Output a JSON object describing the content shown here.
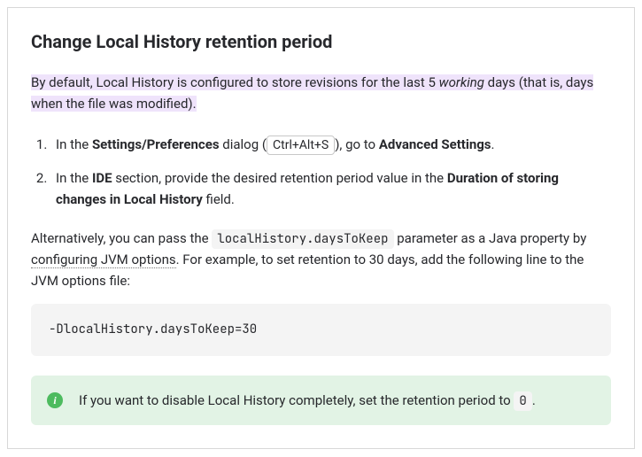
{
  "heading": "Change Local History retention period",
  "intro": {
    "pre": "By default, Local History is configured to store revisions for the last 5 ",
    "em": "working",
    "post": " days (that is, days when the file was modified)."
  },
  "steps": [
    {
      "t1": "In the ",
      "b1": "Settings/Preferences",
      "t2": " dialog (",
      "kbd": "Ctrl+Alt+S",
      "t3": "), go to ",
      "b2": "Advanced Settings",
      "t4": "."
    },
    {
      "t1": "In the ",
      "b1": "IDE",
      "t2": " section, provide the desired retention period value in the ",
      "b2": "Duration of storing changes in Local History",
      "t3": " field."
    }
  ],
  "alt": {
    "t1": "Alternatively, you can pass the ",
    "code": "localHistory.daysToKeep",
    "t2": " parameter as a Java property by ",
    "link": "configuring JVM options",
    "t3": ". For example, to set retention to 30 days, add the following line to the JVM options file:"
  },
  "codeblock": "-DlocalHistory.daysToKeep=30",
  "tip": {
    "icon_glyph": "i",
    "t1": "If you want to disable Local History completely, set the retention period to ",
    "code": "0",
    "t2": "."
  }
}
